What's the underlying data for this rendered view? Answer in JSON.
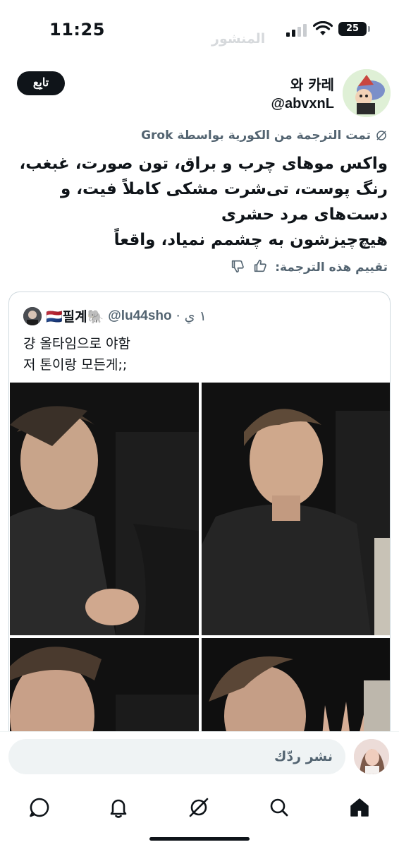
{
  "status_bar": {
    "time": "11:25",
    "battery": "25",
    "faded_header": "المنشور"
  },
  "tweet": {
    "follow_label": "تابِع",
    "display_name": "와 카레",
    "handle": "@abvxnL",
    "translated_note": "تمت الترجمة من الكورية بواسطة Grok",
    "body_lines": [
      "واکس موهای چرب و براق، تون صورت، غبغب،",
      "رنگ پوست، تی‌شرت مشکی کاملاً فیت، و",
      "دست‌های مرد حشری",
      "هیچ‌چیزشون به چشمم نمیاد، واقعاً"
    ],
    "rate_label": "تقييم هذه الترجمة:"
  },
  "quote": {
    "display_name": "🇳🇱필계🐘",
    "handle": "@lu44sho",
    "dot": "·",
    "time": "١ ي",
    "text_lines": [
      "걍 올타임으로 야함",
      "저 톤이랑 모든게;;"
    ]
  },
  "reply": {
    "placeholder": "نشر ردّك"
  },
  "colors": {
    "text": "#0f1419",
    "secondary": "#536471",
    "border": "#cfd9de",
    "input_bg": "#eff3f4"
  },
  "nav_icons": [
    "messages-icon",
    "notifications-icon",
    "grok-icon",
    "search-icon",
    "home-icon"
  ]
}
